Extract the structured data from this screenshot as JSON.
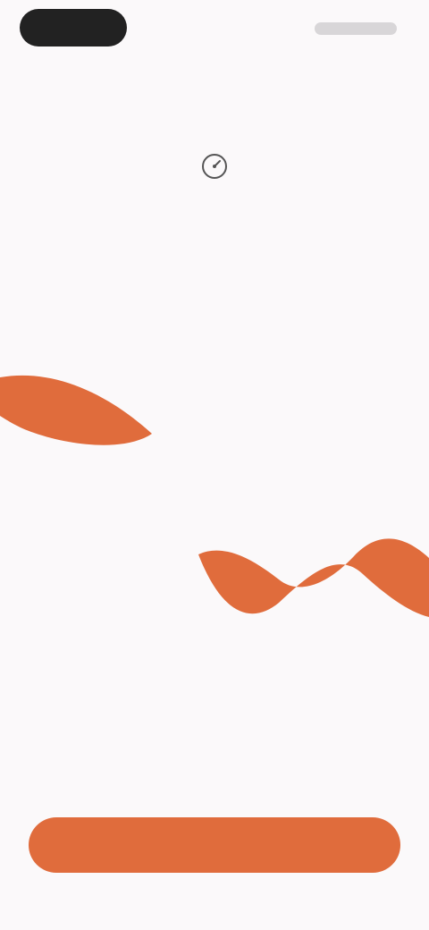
{
  "header": {
    "status_right": ""
  },
  "main": {
    "title": "",
    "subtitle": "",
    "left_label": "",
    "right_label": "",
    "left_value": "",
    "left_value_sub": "",
    "note": "",
    "cta_label": ""
  },
  "colors": {
    "background": "#fbf9fa",
    "accent": "#e06c3c",
    "title": "#2a2a2a",
    "muted": "#bbb8bb"
  },
  "icons": {
    "top": "gauge-icon"
  }
}
